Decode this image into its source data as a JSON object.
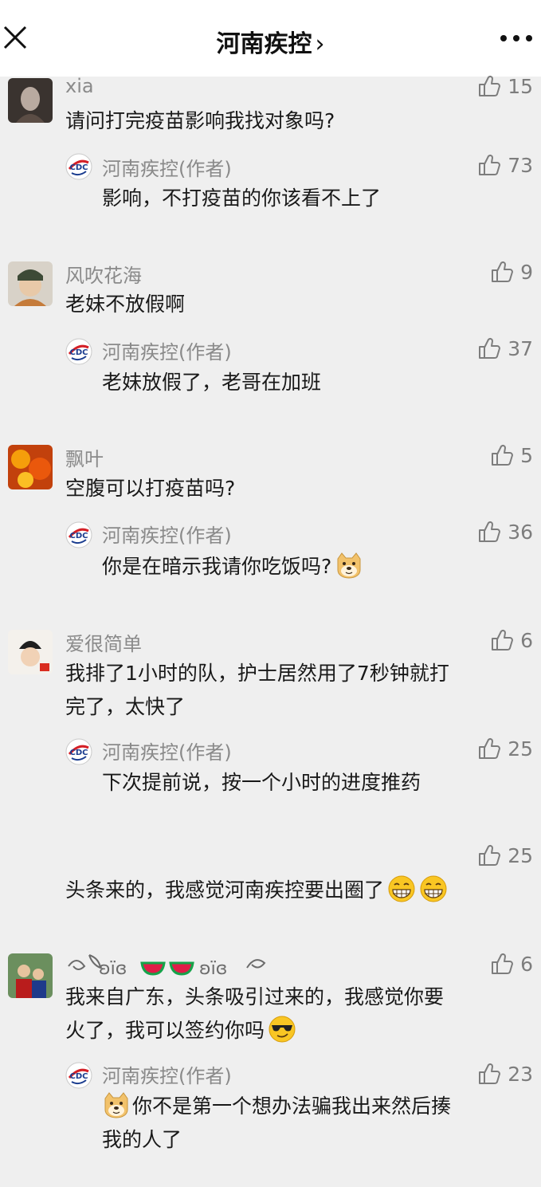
{
  "header": {
    "title": "河南疾控",
    "chevron": "›"
  },
  "icons": {
    "close": "close-icon",
    "more": "more-dots-icon",
    "like": "thumb-up-icon",
    "logo": "cdc-logo-icon",
    "doge": "doge-emoji",
    "grin": "grin-emoji",
    "cool": "sunglasses-emoji"
  },
  "colors": {
    "background": "#efefef",
    "name": "#8a8a8a",
    "text": "#191919",
    "like": "#7d7d7d"
  },
  "comments": [
    {
      "user": "xia",
      "likes": "15",
      "text": "请问打完疫苗影响我找对象吗?",
      "reply": {
        "author": "河南疾控(作者)",
        "likes": "73",
        "text": "影响，不打疫苗的你该看不上了"
      }
    },
    {
      "user": "风吹花海",
      "likes": "9",
      "text": "老妹不放假啊",
      "reply": {
        "author": "河南疾控(作者)",
        "likes": "37",
        "text": "老妹放假了，老哥在加班"
      }
    },
    {
      "user": "飘叶",
      "likes": "5",
      "text": "空腹可以打疫苗吗?",
      "reply": {
        "author": "河南疾控(作者)",
        "likes": "36",
        "text": "你是在暗示我请你吃饭吗?"
      }
    },
    {
      "user": "爱很简单",
      "likes": "6",
      "text_line1": "我排了1小时的队，护士居然用了7秒钟就打",
      "text_line2": "完了，太快了",
      "reply": {
        "author": "河南疾控(作者)",
        "likes": "25",
        "text": "下次提前说，按一个小时的进度推药"
      }
    },
    {
      "user": "",
      "likes": "25",
      "text": "头条来的，我感觉河南疾控要出圈了"
    },
    {
      "user": "",
      "likes": "6",
      "text_line1": "我来自广东，头条吸引过来的，我感觉你要",
      "text_line2": "火了，我可以签约你吗",
      "reply": {
        "author": "河南疾控(作者)",
        "likes": "23",
        "text_line1": "你不是第一个想办法骗我出来然后揍",
        "text_line2": "我的人了"
      }
    }
  ]
}
